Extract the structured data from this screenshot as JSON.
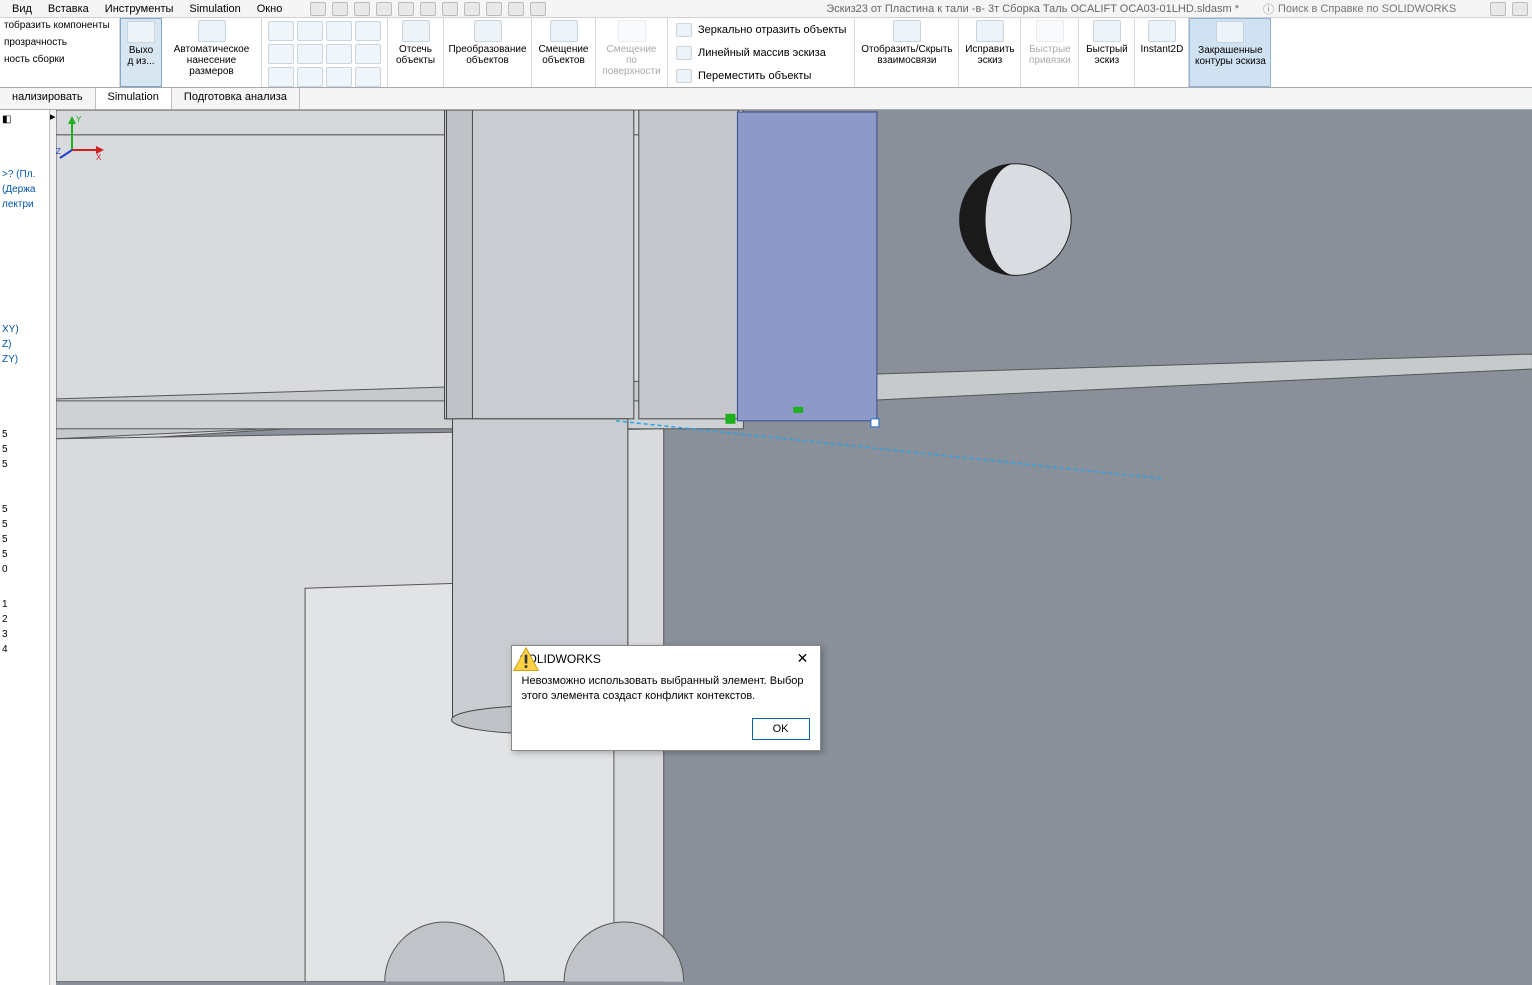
{
  "menu": {
    "view": "Вид",
    "insert": "Вставка",
    "tools": "Инструменты",
    "simulation": "Simulation",
    "window": "Окно"
  },
  "doc_title": "Эскиз23 от Пластина к тали -в- 3т Сборка Таль OCALIFT OCA03-01LHD.sldasm *",
  "search_placeholder": "Поиск в Справке по SOLIDWORKS",
  "ribbon": {
    "show_components": "тобразить компоненты",
    "transparency": "прозрачность",
    "assembly_fit": "ность сборки",
    "exit": "Выхо д из...",
    "auto_dim": "Автоматическое нанесение размеров",
    "trim": "Отсечь объекты",
    "convert": "Преобразование объектов",
    "offset": "Смещение объектов",
    "offset_surface": "Смещение по поверхности",
    "mirror": "Зеркально отразить объекты",
    "linear_pattern": "Линейный массив эскиза",
    "move": "Переместить объекты",
    "show_hide": "Отобразить/Скрыть взаимосвязи",
    "repair": "Исправить эскиз",
    "quick_snaps": "Быстрые привязки",
    "quick_sketch": "Быстрый эскиз",
    "instant2d": "Instant2D",
    "shaded": "Закрашенные контуры эскиза"
  },
  "tabs": {
    "analyze": "нализировать",
    "simulation": "Simulation",
    "prep": "Подготовка анализа"
  },
  "tree": {
    "item1": ">? (Пл.",
    "item2": "(Держа",
    "item3": "лектри",
    "xy": "XY)",
    "xz": "Z)",
    "zy": "ZY)",
    "n0": "0",
    "n1": "1",
    "n2": "2",
    "n3": "3",
    "n4": "4"
  },
  "dialog": {
    "title": "SOLIDWORKS",
    "message": "Невозможно использовать выбранный элемент. Выбор этого элемента создаст конфликт контекстов.",
    "ok": "OK"
  }
}
